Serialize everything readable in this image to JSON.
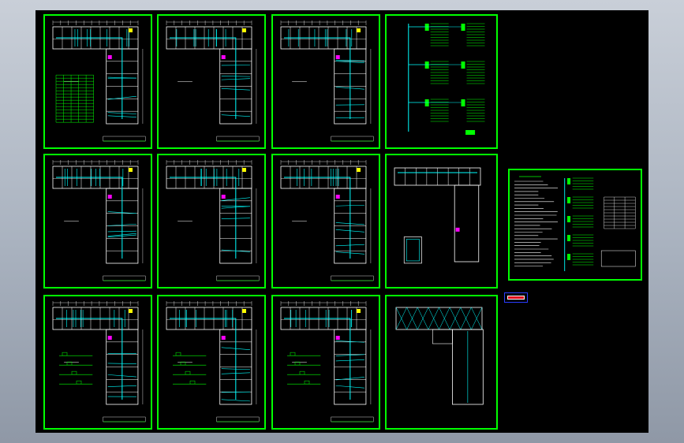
{
  "viewer": {
    "background_color": "#aab3c0",
    "canvas_color": "#000000"
  },
  "colors": {
    "frame": "#00ff00",
    "walls": "#ffffff",
    "wiring": "#00ffff",
    "accent_magenta": "#ff00ff",
    "accent_yellow": "#ffff00",
    "stamp_red": "#e0001a",
    "stamp_blue": "#2a3cff"
  },
  "sheets": [
    {
      "id": "sheet-1-1",
      "kind": "floor-plan-with-table"
    },
    {
      "id": "sheet-1-2",
      "kind": "floor-plan"
    },
    {
      "id": "sheet-1-3",
      "kind": "floor-plan"
    },
    {
      "id": "sheet-1-4",
      "kind": "riser-diagram"
    },
    {
      "id": "sheet-2-1",
      "kind": "floor-plan"
    },
    {
      "id": "sheet-2-2",
      "kind": "floor-plan"
    },
    {
      "id": "sheet-2-3",
      "kind": "floor-plan"
    },
    {
      "id": "sheet-2-4",
      "kind": "partial-plan"
    },
    {
      "id": "sheet-3-1",
      "kind": "floor-plan-with-detail"
    },
    {
      "id": "sheet-3-2",
      "kind": "floor-plan-with-detail"
    },
    {
      "id": "sheet-3-3",
      "kind": "floor-plan-with-detail"
    },
    {
      "id": "sheet-3-4",
      "kind": "roof-plan"
    },
    {
      "id": "sheet-notes",
      "kind": "notes-and-schedule"
    }
  ],
  "stamp": {
    "icon": "legend-stamp-icon"
  }
}
